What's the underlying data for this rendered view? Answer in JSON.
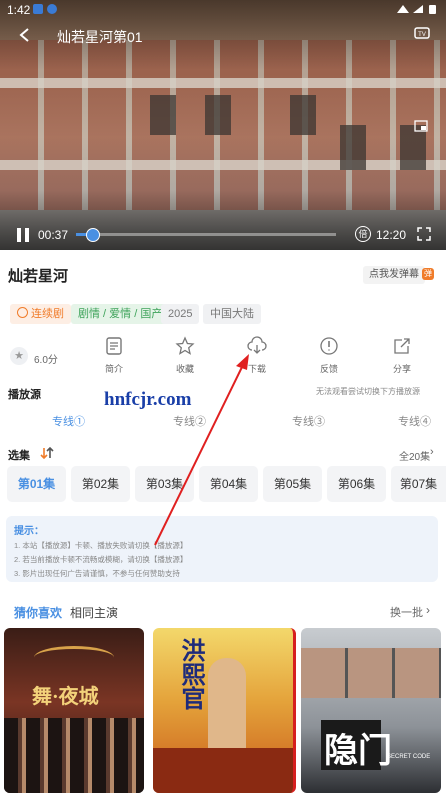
{
  "status_bar": {
    "time": "1:42"
  },
  "player": {
    "title": "灿若星河",
    "episode": "第01",
    "current_time": "00:37",
    "total_time": "12:20",
    "speed_badge": "倍",
    "progress": 0.06
  },
  "show": {
    "title": "灿若星河",
    "danmaku_label": "点我发弹幕",
    "danmaku_badge": "弹",
    "tags": [
      "连续剧",
      "剧情 / 爱情 / 国产",
      "2025",
      "中国大陆"
    ],
    "rating": "6.0分"
  },
  "actions": [
    {
      "label": "简介",
      "icon": "doc-icon"
    },
    {
      "label": "收藏",
      "icon": "star-icon"
    },
    {
      "label": "下载",
      "icon": "cloud-download-icon"
    },
    {
      "label": "反馈",
      "icon": "alert-icon"
    },
    {
      "label": "分享",
      "icon": "share-icon"
    }
  ],
  "source": {
    "title": "播放源",
    "hint": "无法观看尝试切换下方播放源",
    "lines": [
      "专线①",
      "专线②",
      "专线③",
      "专线④"
    ]
  },
  "episodes": {
    "title": "选集",
    "all_label": "全20集",
    "items": [
      "第01集",
      "第02集",
      "第03集",
      "第04集",
      "第05集",
      "第06集",
      "第07集"
    ]
  },
  "tips": {
    "title": "提示：",
    "lines": [
      "1. 本站【播放源】卡顿、播放失败请切换【播放源】",
      "2. 若当前播放卡顿不流畅或模糊，请切换【播放源】",
      "3. 影片出现任何广告请谨慎，不参与任何赞助支持"
    ]
  },
  "recommend": {
    "tabs": [
      "猜你喜欢",
      "相同主演"
    ],
    "refresh": "换一批"
  },
  "posters": [
    {
      "text": "舞·夜城"
    },
    {
      "text": "洪熙官"
    },
    {
      "text": "隐门",
      "sub": "SECRET CODE"
    }
  ],
  "watermark": "hnfcjr.com",
  "colors": {
    "accent": "#4a90e2",
    "annotation": "#e02020",
    "tag_orange": "#f07c2a",
    "tag_green": "#3ea35a"
  }
}
